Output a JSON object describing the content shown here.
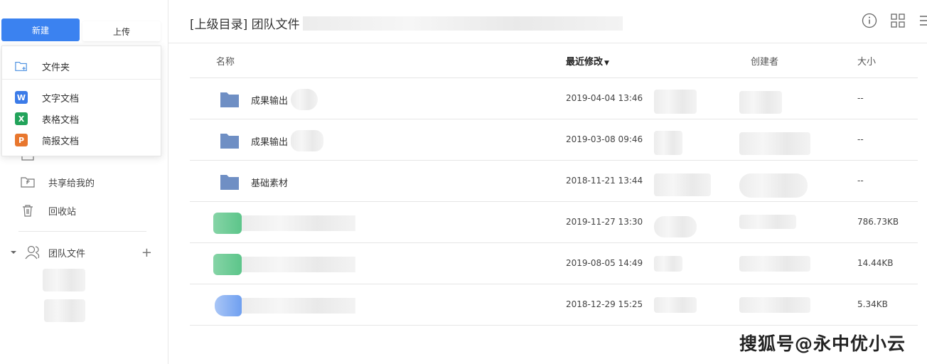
{
  "sidebar": {
    "new_button": "新建",
    "upload_button": "上传",
    "new_menu": {
      "folder": "文件夹",
      "items": [
        {
          "label": "文字文档",
          "icon": "W",
          "color": "#3b7be8"
        },
        {
          "label": "表格文档",
          "icon": "X",
          "color": "#22a35a"
        },
        {
          "label": "简报文档",
          "icon": "P",
          "color": "#e8772e"
        }
      ]
    },
    "nav": {
      "shared_with_me": "共享给我的",
      "recycle_bin": "回收站"
    },
    "team_label": "团队文件"
  },
  "main": {
    "breadcrumb": "[上级目录] 团队文件",
    "columns": {
      "name": "名称",
      "modified": "最近修改",
      "creator": "创建者",
      "size": "大小"
    },
    "rows": [
      {
        "name": "成果输出",
        "type": "folder",
        "modified": "2019-04-04 13:46",
        "size": "--"
      },
      {
        "name": "成果输出",
        "type": "folder",
        "modified": "2019-03-08 09:46",
        "size": "--"
      },
      {
        "name": "基础素材",
        "type": "folder",
        "modified": "2018-11-21 13:44",
        "size": "--"
      },
      {
        "name": "",
        "type": "sheet",
        "modified": "2019-11-27 13:30",
        "size": "786.73KB"
      },
      {
        "name": "",
        "type": "sheet",
        "modified": "2019-08-05 14:49",
        "size": "14.44KB"
      },
      {
        "name": "",
        "type": "doc",
        "modified": "2018-12-29 15:25",
        "size": "5.34KB"
      }
    ]
  },
  "watermark": "搜狐号@永中优小云",
  "colors": {
    "accent": "#3b82f0",
    "folder": "#6f8fc4",
    "sheet": "#5cc58a",
    "doc": "#6f9ff0"
  }
}
